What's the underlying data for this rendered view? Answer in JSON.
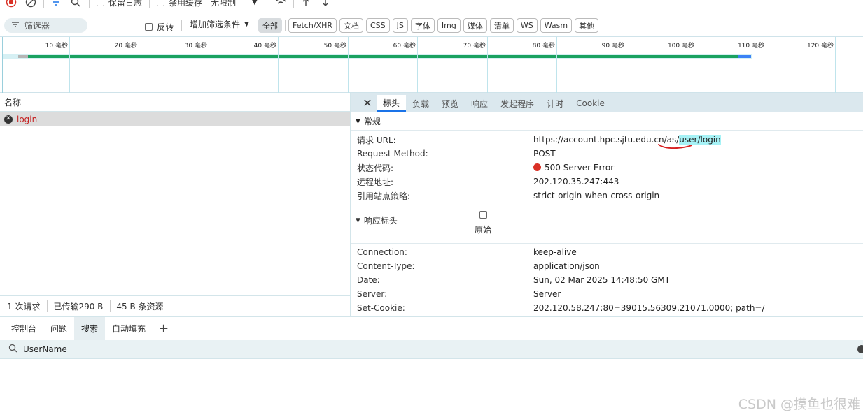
{
  "toolbar": {
    "preserve_log_label": "保留日志",
    "disable_cache_label": "禁用缓存",
    "throttle_value": "无限制"
  },
  "filter": {
    "placeholder": "筛选器",
    "invert_label": "反转",
    "add_filter_label": "增加筛选条件",
    "types": [
      "全部",
      "Fetch/XHR",
      "文档",
      "CSS",
      "JS",
      "字体",
      "Img",
      "媒体",
      "清单",
      "WS",
      "Wasm",
      "其他"
    ],
    "active_type": "全部"
  },
  "timeline": {
    "ticks": [
      "10 毫秒",
      "20 毫秒",
      "30 毫秒",
      "40 毫秒",
      "50 毫秒",
      "60 毫秒",
      "70 毫秒",
      "80 毫秒",
      "90 毫秒",
      "100 毫秒",
      "110 毫秒",
      "120 毫秒"
    ]
  },
  "requests": {
    "header": "名称",
    "items": [
      {
        "name": "login",
        "status": "error"
      }
    ],
    "summary": {
      "count": "1 次请求",
      "transferred": "已传输290 B",
      "resources": "45 B 条资源"
    }
  },
  "details": {
    "tabs": [
      "标头",
      "负载",
      "预览",
      "响应",
      "发起程序",
      "计时",
      "Cookie"
    ],
    "active_tab": "标头",
    "general": {
      "title": "常规",
      "rows": [
        {
          "key": "请求 URL:",
          "value_prefix": "https://account.hpc.sjtu.edu.cn/as/",
          "value_highlight": "user/login"
        },
        {
          "key": "Request Method:",
          "value": "POST"
        },
        {
          "key": "状态代码:",
          "value": "500 Server Error"
        },
        {
          "key": "远程地址:",
          "value": "202.120.35.247:443"
        },
        {
          "key": "引用站点策略:",
          "value": "strict-origin-when-cross-origin"
        }
      ]
    },
    "response_headers": {
      "title": "响应标头",
      "raw_label": "原始",
      "rows": [
        {
          "key": "Connection:",
          "value": "keep-alive"
        },
        {
          "key": "Content-Type:",
          "value": "application/json"
        },
        {
          "key": "Date:",
          "value": "Sun, 02 Mar 2025 14:48:50 GMT"
        },
        {
          "key": "Server:",
          "value": "Server"
        },
        {
          "key": "Set-Cookie:",
          "value": "202.120.58.247:80=39015.56309.21071.0000; path=/"
        }
      ]
    }
  },
  "drawer": {
    "tabs": [
      "控制台",
      "问题",
      "搜索",
      "自动填充"
    ],
    "active_tab": "搜索",
    "search_value": "UserName"
  },
  "watermark": "CSDN @摸鱼也很难",
  "colors": {
    "accent": "#1a73e8",
    "error": "#d93025",
    "success_bar": "#1aa260",
    "highlight": "#a6f2f6"
  }
}
